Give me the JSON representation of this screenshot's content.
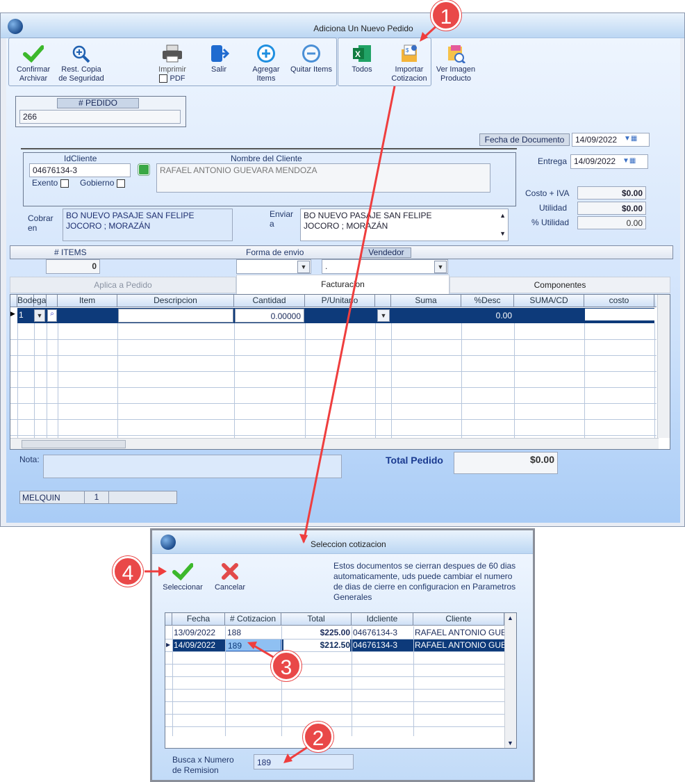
{
  "main_window": {
    "title": "Adiciona Un Nuevo Pedido"
  },
  "toolbar": {
    "confirmar": "Confirmar Archivar",
    "rest_copia": "Rest. Copia de Seguridad",
    "imprimir": "Imprimir",
    "pdf": "PDF",
    "salir": "Salir",
    "agregar": "Agregar Items",
    "quitar": "Quitar Items",
    "todos": "Todos",
    "importar": "Importar Cotizacion",
    "ver_imagen": "Ver Imagen Producto"
  },
  "pedido": {
    "label": "# PEDIDO",
    "value": "266"
  },
  "fecha_documento": {
    "label": "Fecha de  Documento",
    "value": "14/09/2022"
  },
  "entrega": {
    "label": "Entrega",
    "value": "14/09/2022"
  },
  "cliente": {
    "id_label": "IdCliente",
    "id_value": "04676134-3",
    "nombre_label": "Nombre del Cliente",
    "nombre_value": "RAFAEL ANTONIO GUEVARA MENDOZA",
    "exento": "Exento",
    "gobierno": "Gobierno"
  },
  "totals": {
    "costo_label": "Costo + IVA",
    "costo_value": "$0.00",
    "utilidad_label": "Utilidad",
    "utilidad_value": "$0.00",
    "putilidad_label": "% Utilidad",
    "putilidad_value": "0.00"
  },
  "cobrar": {
    "label": "Cobrar en",
    "line1": "BO NUEVO PASAJE SAN FELIPE",
    "line2": "JOCORO ; MORAZÁN"
  },
  "enviar": {
    "label": "Enviar a",
    "line1": "BO NUEVO PASAJE SAN FELIPE",
    "line2": "JOCORO ; MORAZÁN"
  },
  "items_bar": {
    "items_label": "# ITEMS",
    "items_value": "0",
    "forma_label": "Forma de envio",
    "vendedor_label": "Vendedor",
    "vendedor_value": "."
  },
  "tabs": [
    "Aplica a Pedido",
    "Facturacion",
    "Componentes"
  ],
  "grid": {
    "columns": [
      "Bodega",
      "",
      "",
      "Item",
      "Descripcion",
      "Cantidad",
      "P/Unitario",
      "",
      "Suma",
      "%Desc",
      "SUMA/CD",
      "costo"
    ],
    "row": {
      "bodega": "1",
      "cantidad": "0.00000",
      "desc": "0.00"
    }
  },
  "nota": {
    "label": "Nota:"
  },
  "total_pedido": {
    "label": "Total Pedido",
    "value": "$0.00"
  },
  "status": {
    "user": "MELQUIN",
    "num": "1"
  },
  "dialog": {
    "title": "Seleccion cotizacion",
    "seleccionar": "Seleccionar",
    "cancelar": "Cancelar",
    "info": "Estos documentos se cierran despues de 60 dias automaticamente, uds puede cambiar el numero de dias de cierre en configuracion en Parametros Generales",
    "columns": [
      "Fecha",
      "# Cotizacion",
      "Total",
      "Idcliente",
      "Cliente"
    ],
    "rows": [
      {
        "fecha": "13/09/2022",
        "num": "188",
        "total": "$225.00",
        "id": "04676134-3",
        "cliente": "RAFAEL ANTONIO GUE"
      },
      {
        "fecha": "14/09/2022",
        "num": "189",
        "total": "$212.50",
        "id": "04676134-3",
        "cliente": "RAFAEL ANTONIO GUE"
      }
    ],
    "busca_label": "Busca x Numero de Remision",
    "busca_value": "189"
  },
  "badges": [
    "1",
    "2",
    "3",
    "4"
  ]
}
